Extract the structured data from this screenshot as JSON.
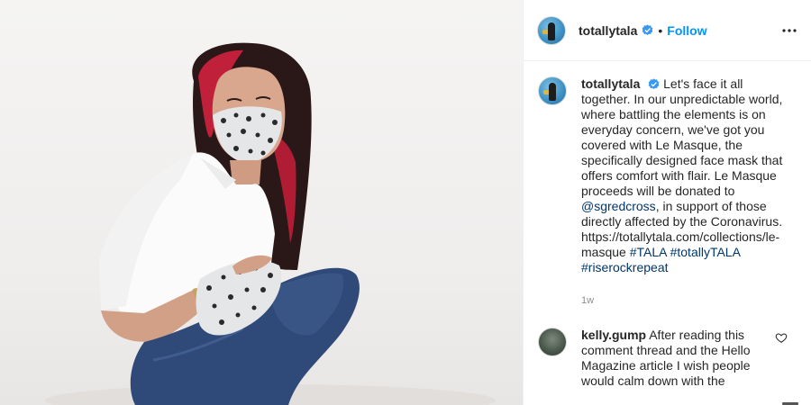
{
  "post": {
    "username": "totallytala",
    "dot": "•",
    "follow_label": "Follow",
    "more_icon": "ellipsis-icon"
  },
  "caption": {
    "username": "totallytala",
    "text_before_link": "Let's face it all together. In our unpredictable world, where battling the elements is on everyday concern, we've got you covered with Le Masque, the specifically designed face mask that offers comfort with flair. Le Masque proceeds will be donated to ",
    "mention": "@sgredcross",
    "text_after_link": ", in support of those directly affected by the Coronavirus. https://totallytala.com/collections/le-masque ",
    "hashtags": [
      "#TALA",
      "#totallyTALA",
      "#riserockrepeat"
    ],
    "timestamp": "1w"
  },
  "comments": [
    {
      "username": "kelly.gump",
      "text": "After reading this comment thread and the Hello Magazine article I wish people would calm down with the"
    }
  ],
  "colors": {
    "link": "#0095f6",
    "hashtag": "#00376b",
    "text": "#262626",
    "muted": "#8e8e8e",
    "verified": "#3897f0"
  }
}
